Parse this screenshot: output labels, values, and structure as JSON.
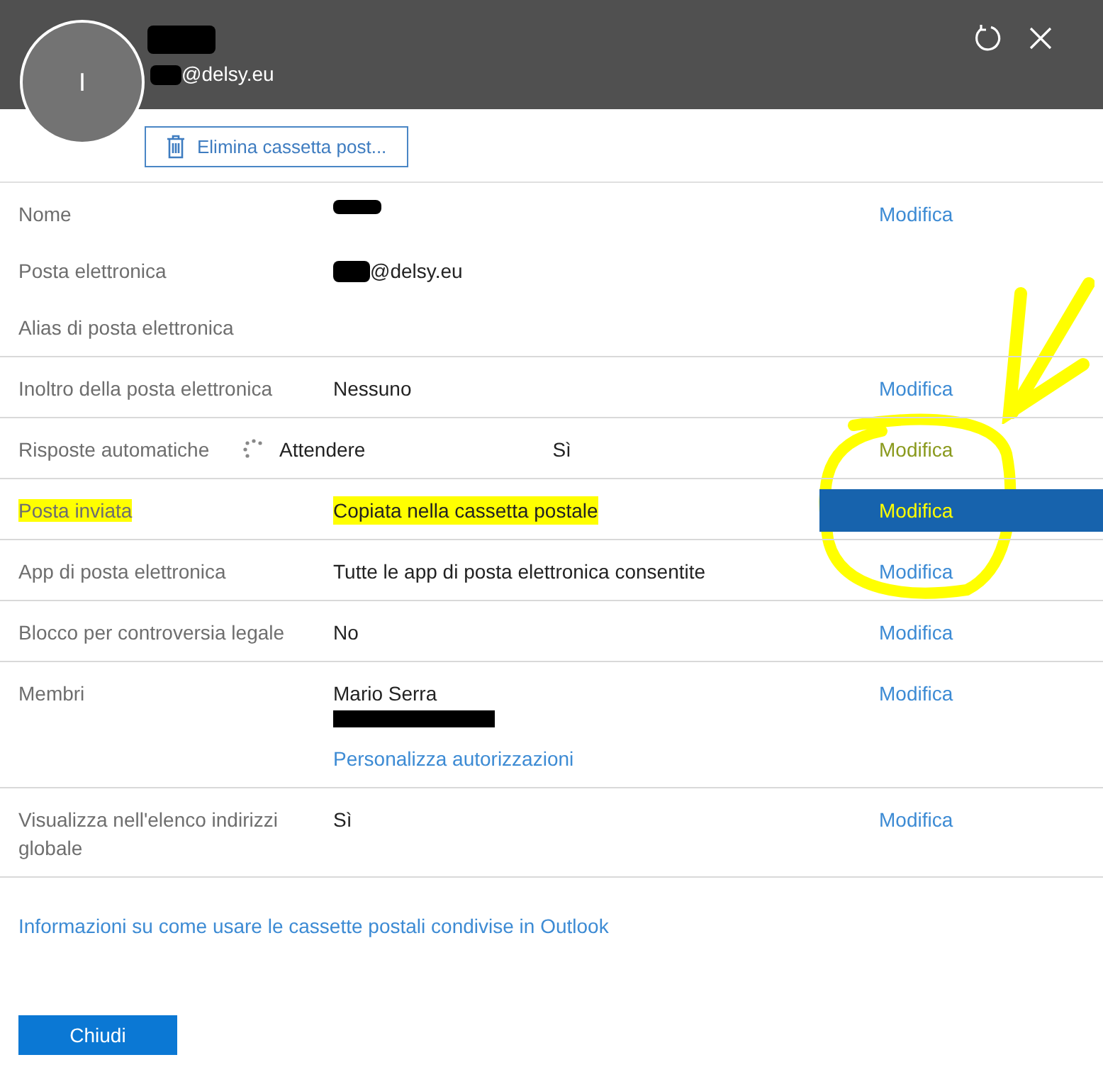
{
  "header": {
    "avatar_letter": "I",
    "name_redacted": true,
    "email": "@delsy.eu",
    "email_redacted": true
  },
  "delete_button": "Elimina cassetta post...",
  "sections": [
    {
      "rows": [
        {
          "label": "Nome",
          "value_redacted": true,
          "action": "Modifica"
        },
        {
          "label": "Posta elettronica",
          "value": "@delsy.eu",
          "value_redacted": true
        },
        {
          "label": "Alias di posta elettronica"
        }
      ]
    },
    {
      "rows": [
        {
          "label": "Inoltro della posta elettronica",
          "value": "Nessuno",
          "action": "Modifica"
        }
      ]
    },
    {
      "rows": [
        {
          "label": "Risposte automatiche",
          "status": "Attendere",
          "value": "Sì",
          "action": "Modifica",
          "action_faded": true
        }
      ]
    },
    {
      "rows": [
        {
          "label": "Posta inviata",
          "value": "Copiata nella cassetta postale",
          "action": "Modifica",
          "highlighted": true,
          "action_selected": true
        }
      ]
    },
    {
      "rows": [
        {
          "label": "App di posta elettronica",
          "value": "Tutte le app di posta elettronica consentite",
          "action": "Modifica"
        }
      ]
    },
    {
      "rows": [
        {
          "label": "Blocco per controversia legale",
          "value": "No",
          "action": "Modifica"
        }
      ]
    },
    {
      "rows": [
        {
          "label": "Membri",
          "value": "Mario Serra",
          "extra_redacted": true,
          "link": "Personalizza autorizzazioni",
          "action": "Modifica"
        }
      ]
    },
    {
      "rows": [
        {
          "label": "Visualizza nell'elenco indirizzi globale",
          "value": "Sì",
          "action": "Modifica"
        }
      ]
    }
  ],
  "info_link": "Informazioni su come usare le cassette postali condivise in Outlook",
  "close_button": "Chiudi",
  "annotations": {
    "arrow": true,
    "loop": true
  }
}
